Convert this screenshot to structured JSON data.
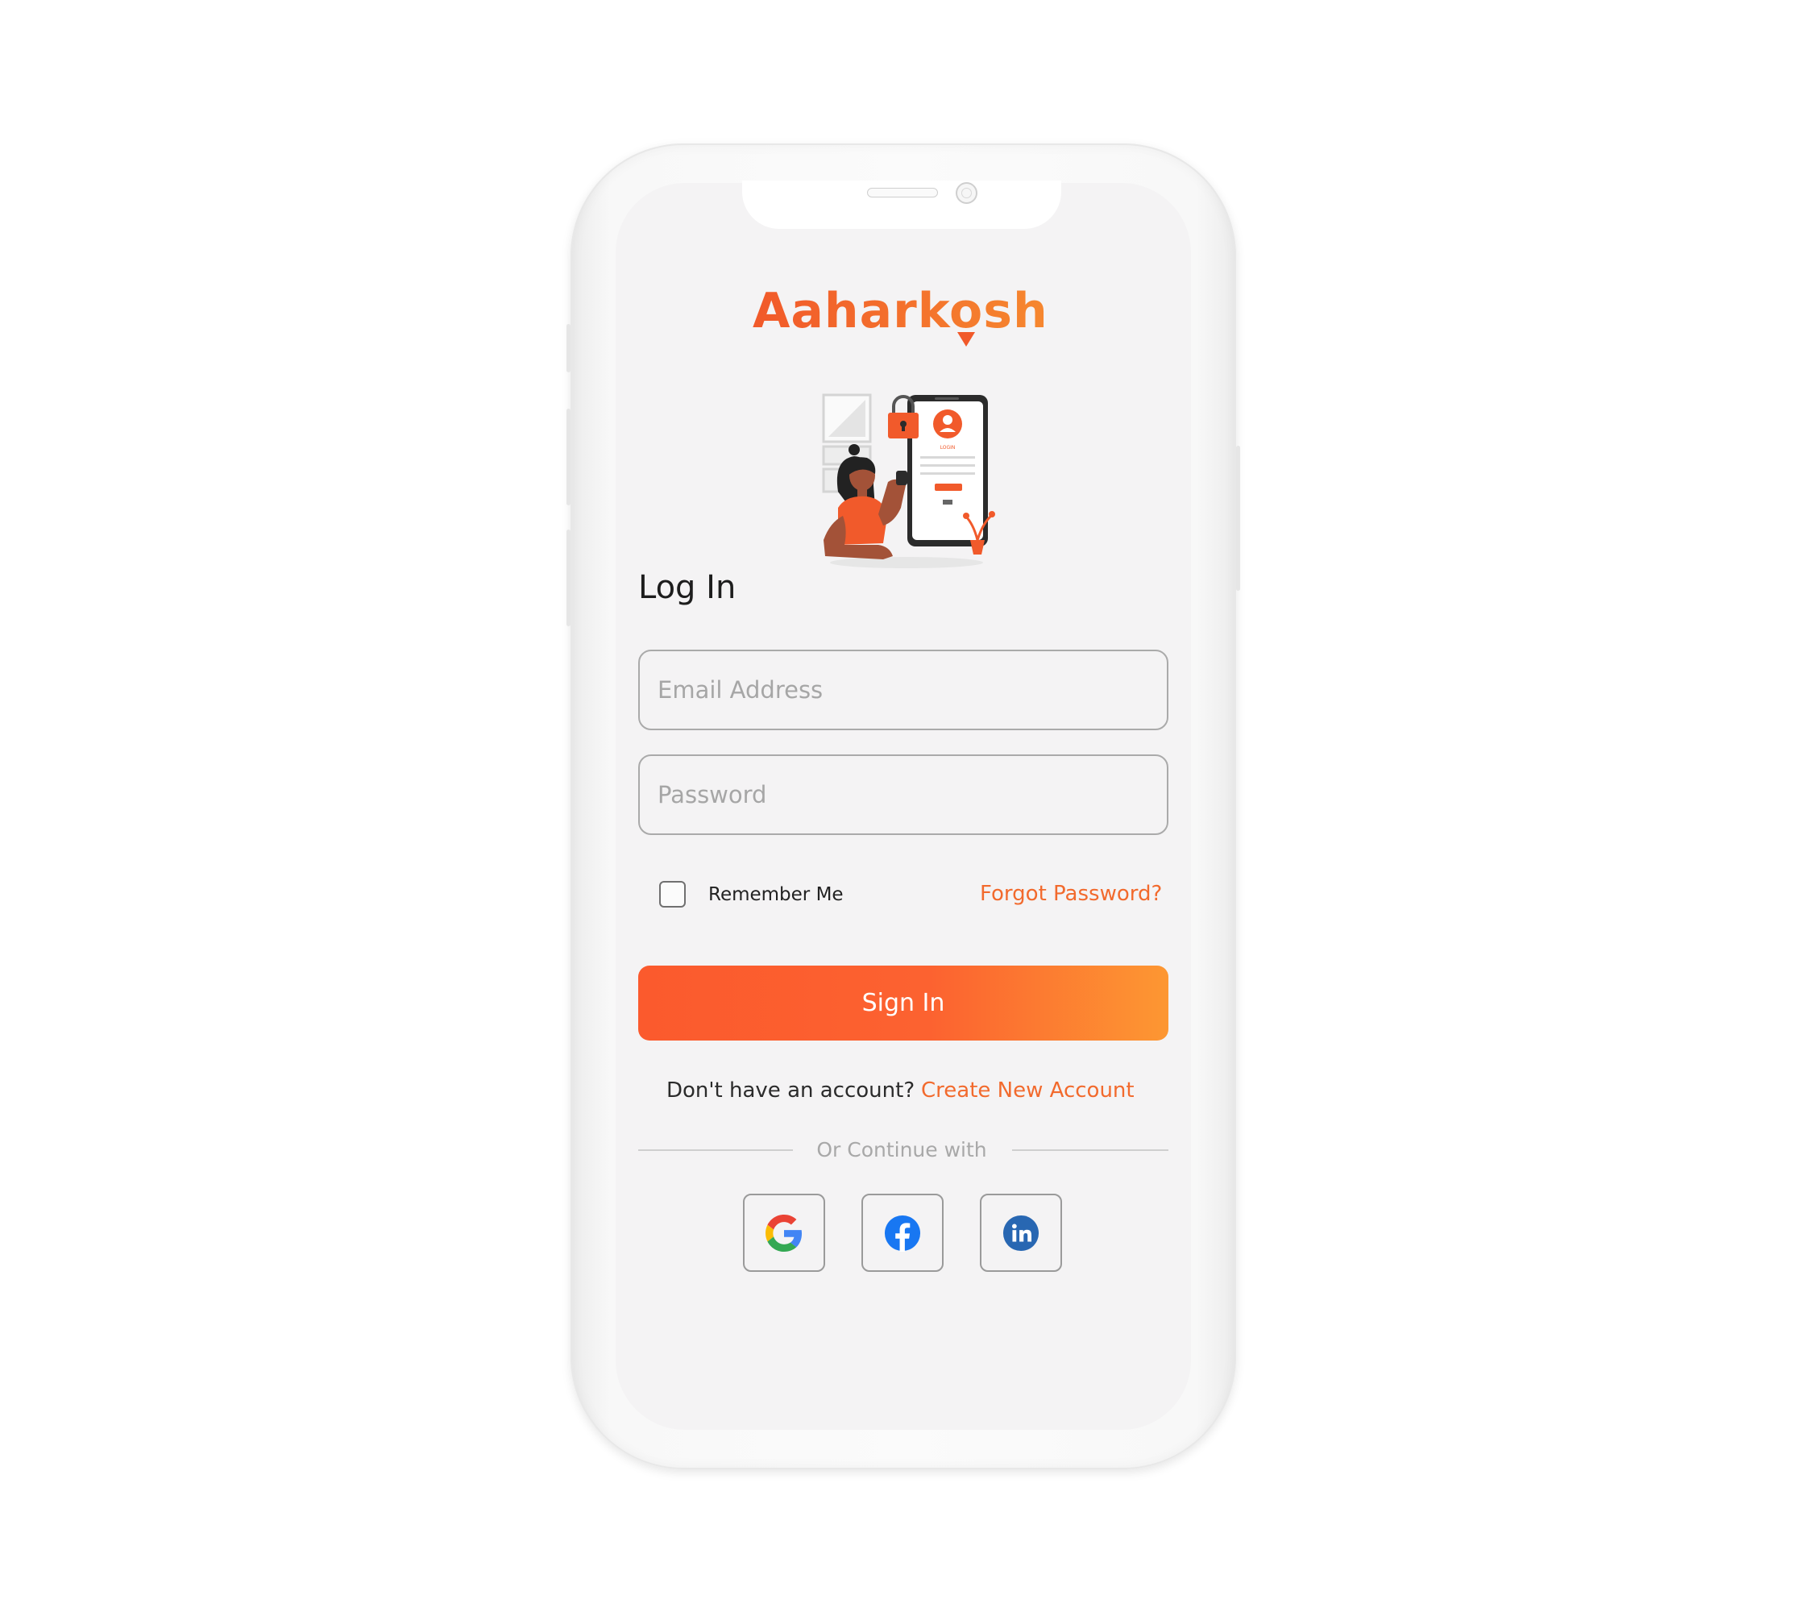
{
  "app": {
    "logo_text": "Aaharkosh",
    "illustration_text": "LOGIN",
    "accent_color": "#f26a2d",
    "gradient": [
      "#fb5a2d",
      "#fd9732"
    ]
  },
  "login": {
    "title": "Log In",
    "email": {
      "placeholder": "Email Address",
      "value": ""
    },
    "password": {
      "placeholder": "Password",
      "value": ""
    },
    "remember_label": "Remember Me",
    "remember_checked": false,
    "forgot_label": "Forgot Password?",
    "signin_label": "Sign In",
    "no_account_text": "Don't have an account?",
    "create_account_label": "Create New Account",
    "continue_with_text": "Or Continue with"
  },
  "social": [
    {
      "name": "google",
      "icon": "google-icon"
    },
    {
      "name": "facebook",
      "icon": "facebook-icon"
    },
    {
      "name": "linkedin",
      "icon": "linkedin-icon"
    }
  ]
}
